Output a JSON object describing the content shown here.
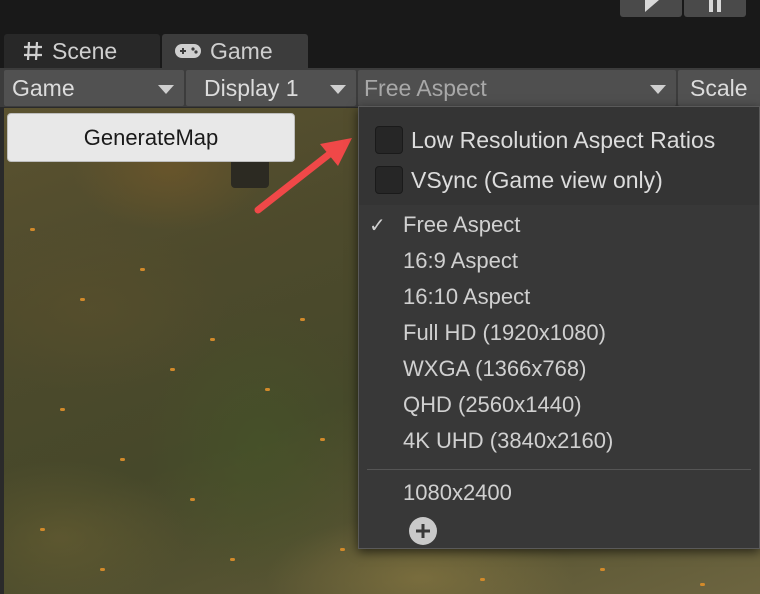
{
  "tabs": {
    "scene_label": "Scene",
    "game_label": "Game"
  },
  "toolbar": {
    "game_select": "Game",
    "display_select": "Display 1",
    "aspect_select": "Free Aspect",
    "scale_label": "Scale"
  },
  "overlay": {
    "generate_button": "GenerateMap"
  },
  "dropdown": {
    "toggles": [
      {
        "label": "Low Resolution Aspect Ratios",
        "checked": false
      },
      {
        "label": "VSync (Game view only)",
        "checked": false
      }
    ],
    "aspects": [
      {
        "label": "Free Aspect",
        "selected": true
      },
      {
        "label": "16:9 Aspect",
        "selected": false
      },
      {
        "label": "16:10 Aspect",
        "selected": false
      },
      {
        "label": "Full HD (1920x1080)",
        "selected": false
      },
      {
        "label": "WXGA (1366x768)",
        "selected": false
      },
      {
        "label": "QHD (2560x1440)",
        "selected": false
      },
      {
        "label": "4K UHD (3840x2160)",
        "selected": false
      }
    ],
    "custom": [
      {
        "label": "1080x2400"
      }
    ],
    "selected_mark": "✓"
  },
  "colors": {
    "accent_arrow": "#f04848",
    "panel_bg": "#383838",
    "toolbar_bg": "#3c3c3c"
  },
  "icons": {
    "play": "play-icon",
    "pause": "pause-icon",
    "scene_tab": "hash-grid-icon",
    "game_tab": "gamepad-icon",
    "add": "plus-circle-icon"
  }
}
